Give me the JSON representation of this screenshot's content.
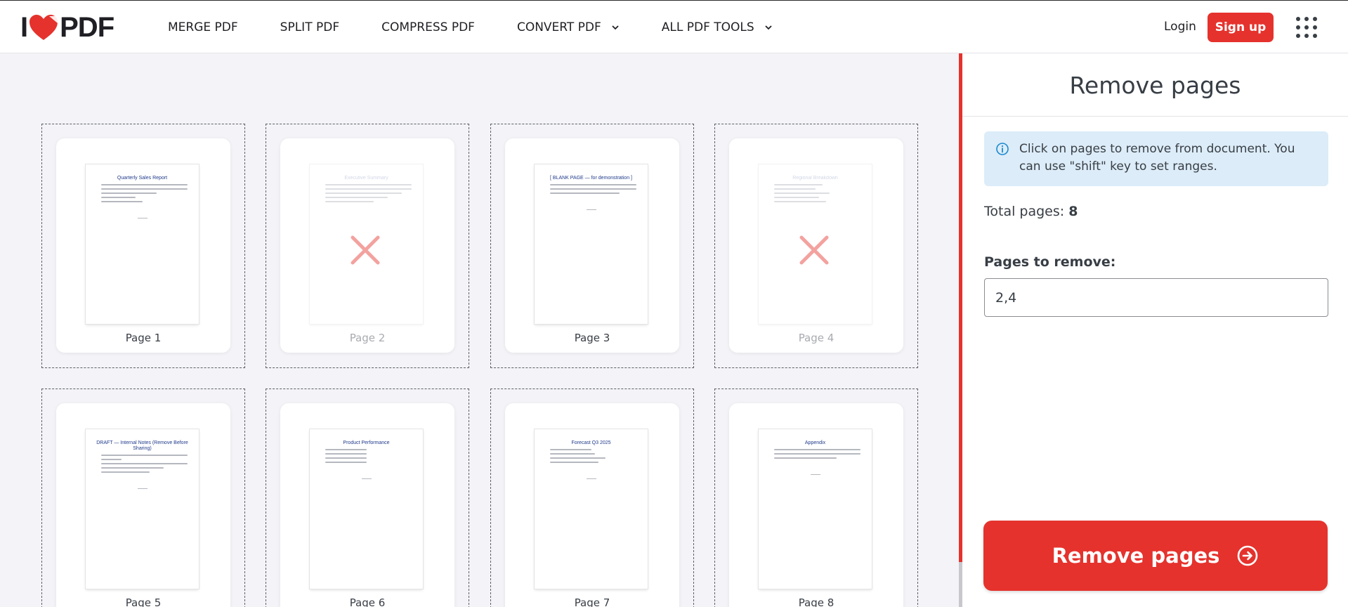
{
  "header": {
    "logo_left": "I",
    "logo_right": "PDF",
    "nav": [
      {
        "label": "MERGE PDF"
      },
      {
        "label": "SPLIT PDF"
      },
      {
        "label": "COMPRESS PDF"
      },
      {
        "label": "CONVERT PDF"
      },
      {
        "label": "ALL PDF TOOLS"
      }
    ],
    "login": "Login",
    "signup": "Sign up"
  },
  "pages": [
    {
      "label": "Page 1",
      "title": "Quarterly Sales Report",
      "removed": false
    },
    {
      "label": "Page 2",
      "title": "Executive Summary",
      "removed": true
    },
    {
      "label": "Page 3",
      "title": "[ BLANK PAGE — for demonstration ]",
      "removed": false
    },
    {
      "label": "Page 4",
      "title": "Regional Breakdown",
      "removed": true
    },
    {
      "label": "Page 5",
      "title": "DRAFT — Internal Notes (Remove Before Sharing)",
      "removed": false
    },
    {
      "label": "Page 6",
      "title": "Product Performance",
      "removed": false
    },
    {
      "label": "Page 7",
      "title": "Forecast Q3 2025",
      "removed": false
    },
    {
      "label": "Page 8",
      "title": "Appendix",
      "removed": false
    }
  ],
  "panel": {
    "title": "Remove pages",
    "info": "Click on pages to remove from document. You can use \"shift\" key to set ranges.",
    "total_label": "Total pages:",
    "total_value": "8",
    "remove_label": "Pages to remove:",
    "remove_value": "2,4",
    "action": "Remove pages"
  },
  "colors": {
    "accent": "#e5322d",
    "info_bg": "#dcecf8",
    "info_icon": "#1a8ad0"
  }
}
